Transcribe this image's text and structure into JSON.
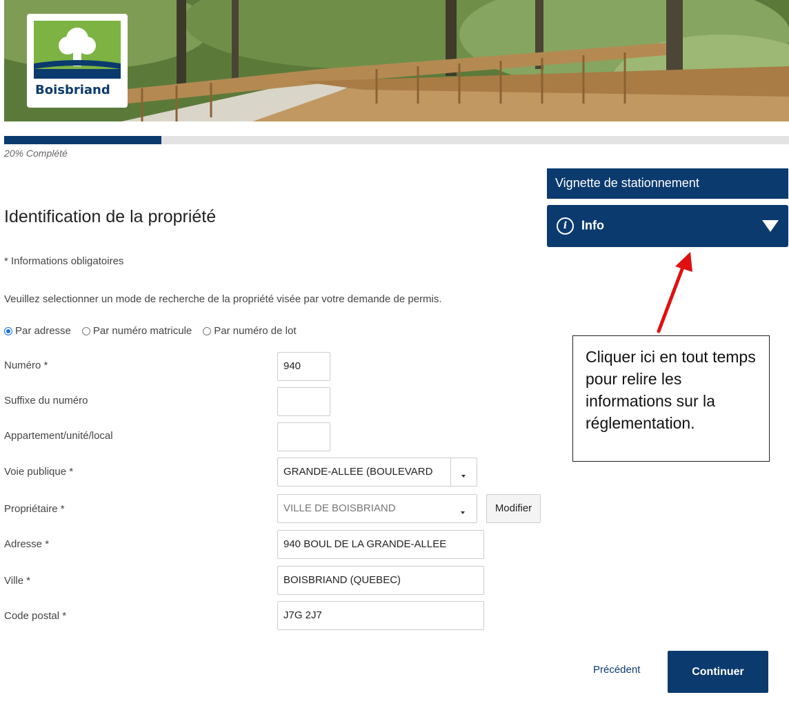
{
  "branding": {
    "logo_text": "Boisbriand"
  },
  "progress": {
    "percent": 20,
    "label": "20% Complété"
  },
  "side_panel": {
    "title": "Vignette de stationnement",
    "info_label": "Info"
  },
  "annotation": {
    "callout_text": "Cliquer ici en tout temps pour relire les informations sur la réglementation."
  },
  "form": {
    "title": "Identification de la propriété",
    "required_note": "* Informations obligatoires",
    "instructions": "Veuillez selectionner un mode de recherche de la propriété visée par votre demande de permis.",
    "search_modes": [
      {
        "label": "Par adresse",
        "selected": true
      },
      {
        "label": "Par numéro matricule",
        "selected": false
      },
      {
        "label": "Par numéro de lot",
        "selected": false
      }
    ],
    "fields": {
      "numero": {
        "label": "Numéro *",
        "value": "940"
      },
      "suffixe": {
        "label": "Suffixe du numéro",
        "value": ""
      },
      "appartement": {
        "label": "Appartement/unité/local",
        "value": ""
      },
      "voie": {
        "label": "Voie publique *",
        "value": "GRANDE-ALLEE (BOULEVARD"
      },
      "proprietaire": {
        "label": "Propriétaire *",
        "value": "VILLE DE BOISBRIAND"
      },
      "adresse": {
        "label": "Adresse *",
        "value": "940 BOUL DE LA GRANDE-ALLEE"
      },
      "ville": {
        "label": "Ville *",
        "value": "BOISBRIAND (QUEBEC)"
      },
      "code_postal": {
        "label": "Code postal *",
        "value": "J7G 2J7"
      }
    },
    "modify_label": "Modifier"
  },
  "nav": {
    "previous_label": "Précédent",
    "continue_label": "Continuer"
  },
  "colors": {
    "primary": "#0b3a6e",
    "annotation_arrow": "#e01010",
    "logo_green": "#7cb342"
  }
}
